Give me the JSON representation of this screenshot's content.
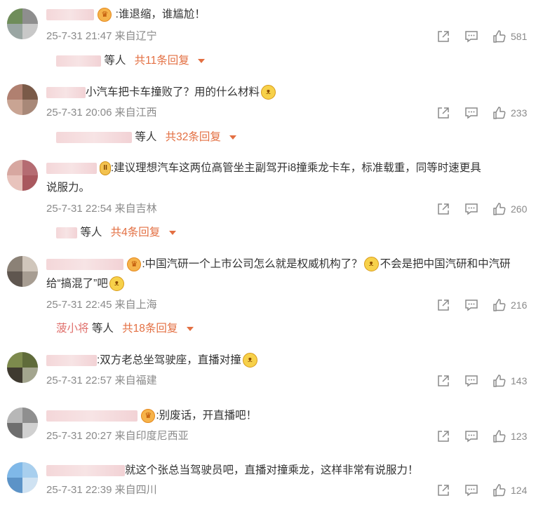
{
  "comments": [
    {
      "text": ":谁退缩，谁尴尬！",
      "date": "25-7-31 21:47",
      "location": "来自辽宁",
      "likes": "581",
      "replies": {
        "who": "等人",
        "count": "共11条回复"
      }
    },
    {
      "text": "小汽车把卡车撞败了？用的什么材料",
      "date": "25-7-31 20:06",
      "location": "来自江西",
      "likes": "233",
      "replies": {
        "who": "等人",
        "count": "共32条回复"
      }
    },
    {
      "vip": "II",
      "text_line1": ":建议理想汽车这两位高管坐主副驾开i8撞乘龙卡车，标准载重，同等时速更具",
      "text_line2": "说服力。",
      "date": "25-7-31 22:54",
      "location": "来自吉林",
      "likes": "260",
      "replies": {
        "who": "等人",
        "count": "共4条回复"
      }
    },
    {
      "text_a": ":中国汽研一个上市公司怎么就是权威机构了？",
      "text_b": "不会是把中国汽研和中汽研",
      "text_line2": "给“搞混了”吧",
      "date": "25-7-31 22:45",
      "location": "来自上海",
      "likes": "216",
      "replies": {
        "name": "菠小将",
        "who": "等人",
        "count": "共18条回复"
      }
    },
    {
      "text": ":双方老总坐驾驶座，直播对撞",
      "date": "25-7-31 22:57",
      "location": "来自福建",
      "likes": "143"
    },
    {
      "text": ":别废话，开直播吧！",
      "date": "25-7-31 20:27",
      "location": "来自印度尼西亚",
      "likes": "123"
    },
    {
      "text": "就这个张总当驾驶员吧，直播对撞乘龙，这样非常有说服力！",
      "date": "25-7-31 22:39",
      "location": "来自四川",
      "likes": "124"
    }
  ],
  "icons": {
    "share": "share-icon",
    "comment": "comment-icon",
    "like": "thumbs-up-icon"
  },
  "colors": {
    "reply_count": "#e36f42",
    "meta": "#8a8a8a",
    "text": "#333333"
  }
}
